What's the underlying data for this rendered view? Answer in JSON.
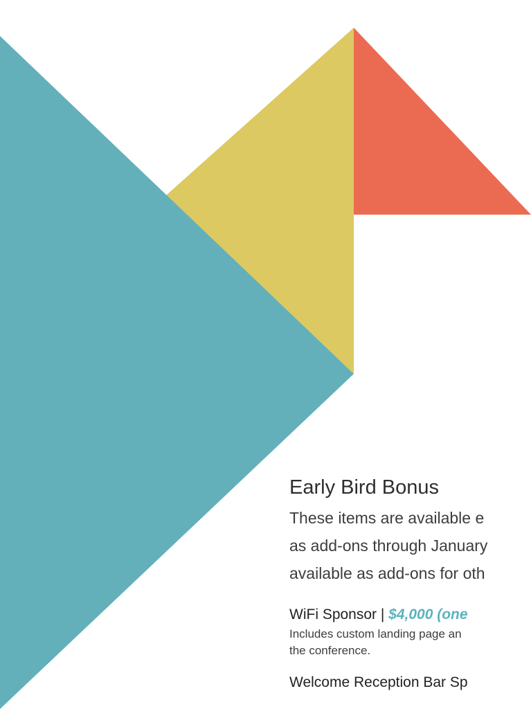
{
  "colors": {
    "teal": "#63b0ba",
    "yellow": "#dcc962",
    "coral": "#eb6b52",
    "price_accent": "#5bb3bd",
    "background": "#ffffff"
  },
  "section": {
    "heading": "Early Bird Bonus",
    "intro_lines": [
      "These items are available e",
      "as add-ons through January",
      "available as add-ons for oth"
    ]
  },
  "items": [
    {
      "title": "WiFi Sponsor | ",
      "price": "$4,000 (one",
      "desc_lines": [
        "Includes custom landing page an",
        "the conference."
      ]
    },
    {
      "title": "Welcome Reception Bar Sp",
      "price": "",
      "desc_lines": []
    }
  ]
}
